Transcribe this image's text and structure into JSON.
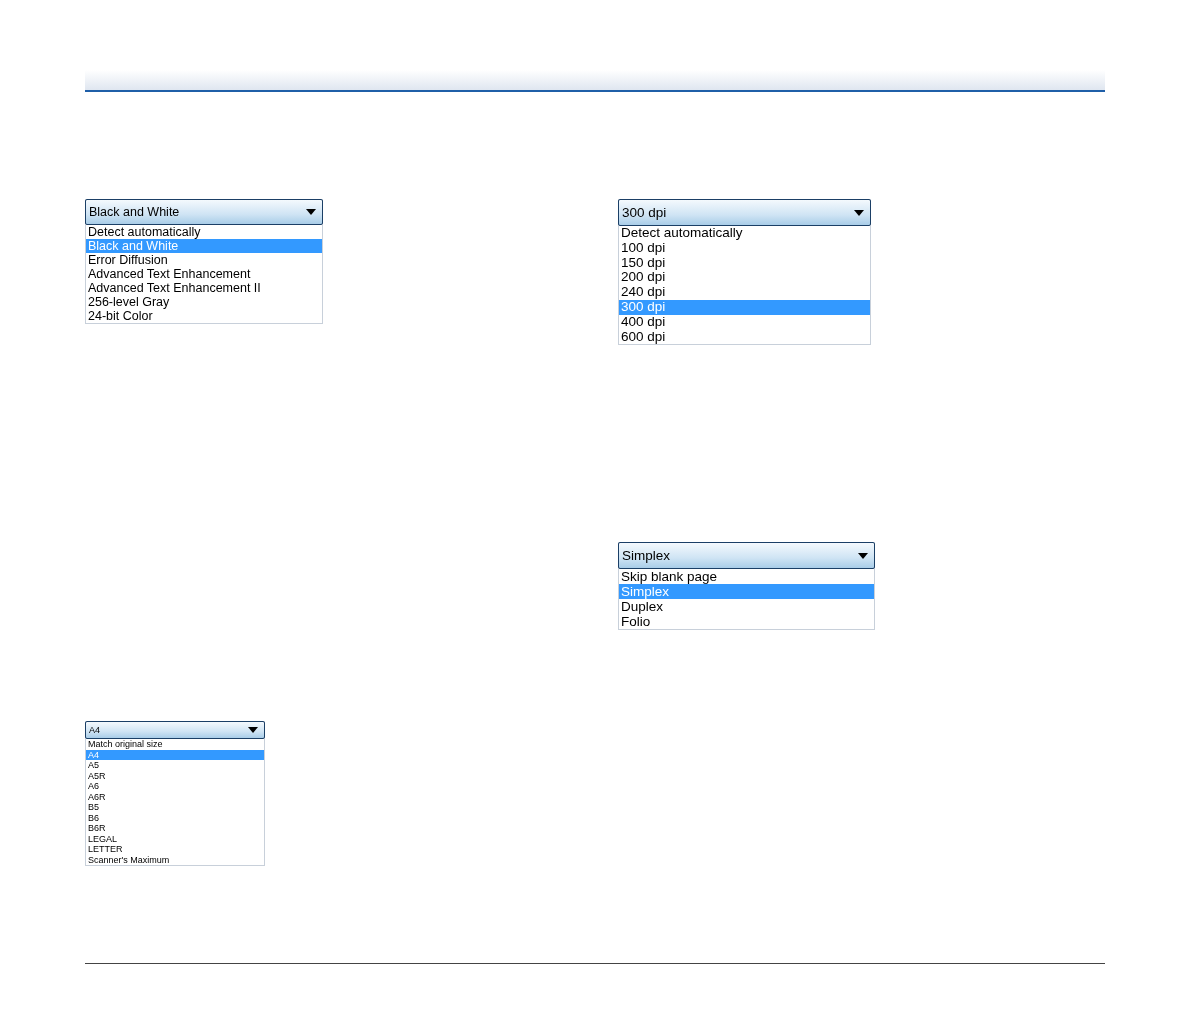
{
  "left_column": [
    {
      "value": "Black and White",
      "options": [
        {
          "label": "Detect automatically",
          "selected": false
        },
        {
          "label": "Black and White",
          "selected": true
        },
        {
          "label": "Error Diffusion",
          "selected": false
        },
        {
          "label": "Advanced Text Enhancement",
          "selected": false
        },
        {
          "label": "Advanced Text Enhancement II",
          "selected": false
        },
        {
          "label": "256-level Gray",
          "selected": false
        },
        {
          "label": "24-bit Color",
          "selected": false
        }
      ]
    },
    {
      "value": "A4",
      "options": [
        {
          "label": "Match original size",
          "selected": false
        },
        {
          "label": "A4",
          "selected": true
        },
        {
          "label": "A5",
          "selected": false
        },
        {
          "label": "A5R",
          "selected": false
        },
        {
          "label": "A6",
          "selected": false
        },
        {
          "label": "A6R",
          "selected": false
        },
        {
          "label": "B5",
          "selected": false
        },
        {
          "label": "B6",
          "selected": false
        },
        {
          "label": "B6R",
          "selected": false
        },
        {
          "label": "LEGAL",
          "selected": false
        },
        {
          "label": "LETTER",
          "selected": false
        },
        {
          "label": "Scanner's Maximum",
          "selected": false
        }
      ]
    }
  ],
  "right_column": [
    {
      "value": "300 dpi",
      "options": [
        {
          "label": "Detect automatically",
          "selected": false
        },
        {
          "label": "100 dpi",
          "selected": false
        },
        {
          "label": "150 dpi",
          "selected": false
        },
        {
          "label": "200 dpi",
          "selected": false
        },
        {
          "label": "240 dpi",
          "selected": false
        },
        {
          "label": "300 dpi",
          "selected": true
        },
        {
          "label": "400 dpi",
          "selected": false
        },
        {
          "label": "600 dpi",
          "selected": false
        }
      ]
    },
    {
      "value": "Simplex",
      "options": [
        {
          "label": "Skip blank page",
          "selected": false
        },
        {
          "label": "Simplex",
          "selected": true
        },
        {
          "label": "Duplex",
          "selected": false
        },
        {
          "label": "Folio",
          "selected": false
        }
      ]
    }
  ]
}
